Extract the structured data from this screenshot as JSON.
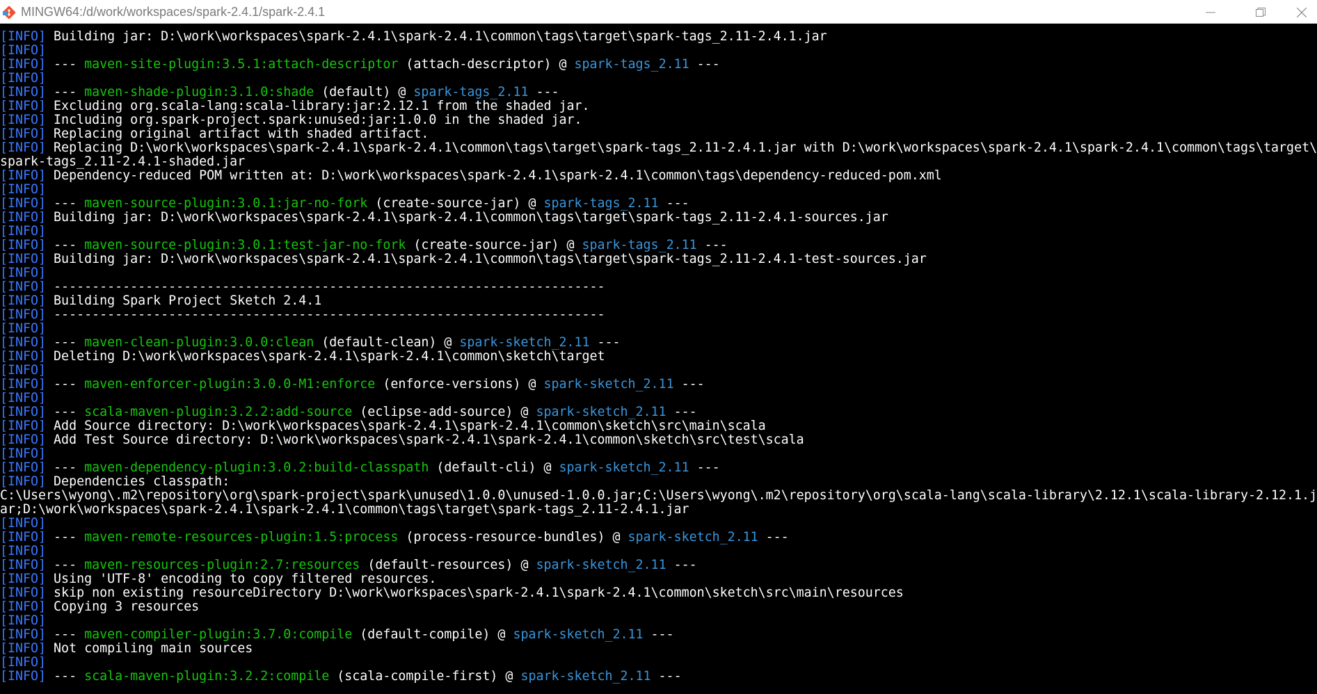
{
  "window": {
    "title": "MINGW64:/d/work/workspaces/spark-2.4.1/spark-2.4.1",
    "icon": "git-bash-icon",
    "buttons": [
      "minimize-icon",
      "maximize-icon",
      "close-icon"
    ]
  },
  "colors": {
    "background": "#000000",
    "text": "#ffffff",
    "info_tag": "#3b78ff",
    "plugin": "#16c60c",
    "artifact": "#3a96dd"
  },
  "terminal": {
    "lines": [
      {
        "tag": "[INFO]",
        "segments": [
          {
            "t": " Building jar: D:\\work\\workspaces\\spark-2.4.1\\spark-2.4.1\\common\\tags\\target\\spark-tags_2.11-2.4.1.jar",
            "c": "w"
          }
        ]
      },
      {
        "tag": "[INFO]",
        "segments": []
      },
      {
        "tag": "[INFO]",
        "segments": [
          {
            "t": " --- ",
            "c": "w"
          },
          {
            "t": "maven-site-plugin:3.5.1:attach-descriptor",
            "c": "g"
          },
          {
            "t": " (attach-descriptor) @ ",
            "c": "w"
          },
          {
            "t": "spark-tags_2.11",
            "c": "c"
          },
          {
            "t": " ---",
            "c": "w"
          }
        ]
      },
      {
        "tag": "[INFO]",
        "segments": []
      },
      {
        "tag": "[INFO]",
        "segments": [
          {
            "t": " --- ",
            "c": "w"
          },
          {
            "t": "maven-shade-plugin:3.1.0:shade",
            "c": "g"
          },
          {
            "t": " (default) @ ",
            "c": "w"
          },
          {
            "t": "spark-tags_2.11",
            "c": "c"
          },
          {
            "t": " ---",
            "c": "w"
          }
        ]
      },
      {
        "tag": "[INFO]",
        "segments": [
          {
            "t": " Excluding org.scala-lang:scala-library:jar:2.12.1 from the shaded jar.",
            "c": "w"
          }
        ]
      },
      {
        "tag": "[INFO]",
        "segments": [
          {
            "t": " Including org.spark-project.spark:unused:jar:1.0.0 in the shaded jar.",
            "c": "w"
          }
        ]
      },
      {
        "tag": "[INFO]",
        "segments": [
          {
            "t": " Replacing original artifact with shaded artifact.",
            "c": "w"
          }
        ]
      },
      {
        "tag": "[INFO]",
        "segments": [
          {
            "t": " Replacing D:\\work\\workspaces\\spark-2.4.1\\spark-2.4.1\\common\\tags\\target\\spark-tags_2.11-2.4.1.jar with D:\\work\\workspaces\\spark-2.4.1\\spark-2.4.1\\common\\tags\\target\\",
            "c": "w"
          }
        ]
      },
      {
        "tag": "",
        "segments": [
          {
            "t": "spark-tags_2.11-2.4.1-shaded.jar",
            "c": "w"
          }
        ]
      },
      {
        "tag": "[INFO]",
        "segments": [
          {
            "t": " Dependency-reduced POM written at: D:\\work\\workspaces\\spark-2.4.1\\spark-2.4.1\\common\\tags\\dependency-reduced-pom.xml",
            "c": "w"
          }
        ]
      },
      {
        "tag": "[INFO]",
        "segments": []
      },
      {
        "tag": "[INFO]",
        "segments": [
          {
            "t": " --- ",
            "c": "w"
          },
          {
            "t": "maven-source-plugin:3.0.1:jar-no-fork",
            "c": "g"
          },
          {
            "t": " (create-source-jar) @ ",
            "c": "w"
          },
          {
            "t": "spark-tags_2.11",
            "c": "c"
          },
          {
            "t": " ---",
            "c": "w"
          }
        ]
      },
      {
        "tag": "[INFO]",
        "segments": [
          {
            "t": " Building jar: D:\\work\\workspaces\\spark-2.4.1\\spark-2.4.1\\common\\tags\\target\\spark-tags_2.11-2.4.1-sources.jar",
            "c": "w"
          }
        ]
      },
      {
        "tag": "[INFO]",
        "segments": []
      },
      {
        "tag": "[INFO]",
        "segments": [
          {
            "t": " --- ",
            "c": "w"
          },
          {
            "t": "maven-source-plugin:3.0.1:test-jar-no-fork",
            "c": "g"
          },
          {
            "t": " (create-source-jar) @ ",
            "c": "w"
          },
          {
            "t": "spark-tags_2.11",
            "c": "c"
          },
          {
            "t": " ---",
            "c": "w"
          }
        ]
      },
      {
        "tag": "[INFO]",
        "segments": [
          {
            "t": " Building jar: D:\\work\\workspaces\\spark-2.4.1\\spark-2.4.1\\common\\tags\\target\\spark-tags_2.11-2.4.1-test-sources.jar",
            "c": "w"
          }
        ]
      },
      {
        "tag": "[INFO]",
        "segments": []
      },
      {
        "tag": "[INFO]",
        "segments": [
          {
            "t": " ------------------------------------------------------------------------",
            "c": "w"
          }
        ]
      },
      {
        "tag": "[INFO]",
        "segments": [
          {
            "t": " Building Spark Project Sketch 2.4.1",
            "c": "w"
          }
        ]
      },
      {
        "tag": "[INFO]",
        "segments": [
          {
            "t": " ------------------------------------------------------------------------",
            "c": "w"
          }
        ]
      },
      {
        "tag": "[INFO]",
        "segments": []
      },
      {
        "tag": "[INFO]",
        "segments": [
          {
            "t": " --- ",
            "c": "w"
          },
          {
            "t": "maven-clean-plugin:3.0.0:clean",
            "c": "g"
          },
          {
            "t": " (default-clean) @ ",
            "c": "w"
          },
          {
            "t": "spark-sketch_2.11",
            "c": "c"
          },
          {
            "t": " ---",
            "c": "w"
          }
        ]
      },
      {
        "tag": "[INFO]",
        "segments": [
          {
            "t": " Deleting D:\\work\\workspaces\\spark-2.4.1\\spark-2.4.1\\common\\sketch\\target",
            "c": "w"
          }
        ]
      },
      {
        "tag": "[INFO]",
        "segments": []
      },
      {
        "tag": "[INFO]",
        "segments": [
          {
            "t": " --- ",
            "c": "w"
          },
          {
            "t": "maven-enforcer-plugin:3.0.0-M1:enforce",
            "c": "g"
          },
          {
            "t": " (enforce-versions) @ ",
            "c": "w"
          },
          {
            "t": "spark-sketch_2.11",
            "c": "c"
          },
          {
            "t": " ---",
            "c": "w"
          }
        ]
      },
      {
        "tag": "[INFO]",
        "segments": []
      },
      {
        "tag": "[INFO]",
        "segments": [
          {
            "t": " --- ",
            "c": "w"
          },
          {
            "t": "scala-maven-plugin:3.2.2:add-source",
            "c": "g"
          },
          {
            "t": " (eclipse-add-source) @ ",
            "c": "w"
          },
          {
            "t": "spark-sketch_2.11",
            "c": "c"
          },
          {
            "t": " ---",
            "c": "w"
          }
        ]
      },
      {
        "tag": "[INFO]",
        "segments": [
          {
            "t": " Add Source directory: D:\\work\\workspaces\\spark-2.4.1\\spark-2.4.1\\common\\sketch\\src\\main\\scala",
            "c": "w"
          }
        ]
      },
      {
        "tag": "[INFO]",
        "segments": [
          {
            "t": " Add Test Source directory: D:\\work\\workspaces\\spark-2.4.1\\spark-2.4.1\\common\\sketch\\src\\test\\scala",
            "c": "w"
          }
        ]
      },
      {
        "tag": "[INFO]",
        "segments": []
      },
      {
        "tag": "[INFO]",
        "segments": [
          {
            "t": " --- ",
            "c": "w"
          },
          {
            "t": "maven-dependency-plugin:3.0.2:build-classpath",
            "c": "g"
          },
          {
            "t": " (default-cli) @ ",
            "c": "w"
          },
          {
            "t": "spark-sketch_2.11",
            "c": "c"
          },
          {
            "t": " ---",
            "c": "w"
          }
        ]
      },
      {
        "tag": "[INFO]",
        "segments": [
          {
            "t": " Dependencies classpath:",
            "c": "w"
          }
        ]
      },
      {
        "tag": "",
        "segments": [
          {
            "t": "C:\\Users\\wyong\\.m2\\repository\\org\\spark-project\\spark\\unused\\1.0.0\\unused-1.0.0.jar;C:\\Users\\wyong\\.m2\\repository\\org\\scala-lang\\scala-library\\2.12.1\\scala-library-2.12.1.j",
            "c": "w"
          }
        ]
      },
      {
        "tag": "",
        "segments": [
          {
            "t": "ar;D:\\work\\workspaces\\spark-2.4.1\\spark-2.4.1\\common\\tags\\target\\spark-tags_2.11-2.4.1.jar",
            "c": "w"
          }
        ]
      },
      {
        "tag": "[INFO]",
        "segments": []
      },
      {
        "tag": "[INFO]",
        "segments": [
          {
            "t": " --- ",
            "c": "w"
          },
          {
            "t": "maven-remote-resources-plugin:1.5:process",
            "c": "g"
          },
          {
            "t": " (process-resource-bundles) @ ",
            "c": "w"
          },
          {
            "t": "spark-sketch_2.11",
            "c": "c"
          },
          {
            "t": " ---",
            "c": "w"
          }
        ]
      },
      {
        "tag": "[INFO]",
        "segments": []
      },
      {
        "tag": "[INFO]",
        "segments": [
          {
            "t": " --- ",
            "c": "w"
          },
          {
            "t": "maven-resources-plugin:2.7:resources",
            "c": "g"
          },
          {
            "t": " (default-resources) @ ",
            "c": "w"
          },
          {
            "t": "spark-sketch_2.11",
            "c": "c"
          },
          {
            "t": " ---",
            "c": "w"
          }
        ]
      },
      {
        "tag": "[INFO]",
        "segments": [
          {
            "t": " Using 'UTF-8' encoding to copy filtered resources.",
            "c": "w"
          }
        ]
      },
      {
        "tag": "[INFO]",
        "segments": [
          {
            "t": " skip non existing resourceDirectory D:\\work\\workspaces\\spark-2.4.1\\spark-2.4.1\\common\\sketch\\src\\main\\resources",
            "c": "w"
          }
        ]
      },
      {
        "tag": "[INFO]",
        "segments": [
          {
            "t": " Copying 3 resources",
            "c": "w"
          }
        ]
      },
      {
        "tag": "[INFO]",
        "segments": []
      },
      {
        "tag": "[INFO]",
        "segments": [
          {
            "t": " --- ",
            "c": "w"
          },
          {
            "t": "maven-compiler-plugin:3.7.0:compile",
            "c": "g"
          },
          {
            "t": " (default-compile) @ ",
            "c": "w"
          },
          {
            "t": "spark-sketch_2.11",
            "c": "c"
          },
          {
            "t": " ---",
            "c": "w"
          }
        ]
      },
      {
        "tag": "[INFO]",
        "segments": [
          {
            "t": " Not compiling main sources",
            "c": "w"
          }
        ]
      },
      {
        "tag": "[INFO]",
        "segments": []
      },
      {
        "tag": "[INFO]",
        "segments": [
          {
            "t": " --- ",
            "c": "w"
          },
          {
            "t": "scala-maven-plugin:3.2.2:compile",
            "c": "g"
          },
          {
            "t": " (scala-compile-first) @ ",
            "c": "w"
          },
          {
            "t": "spark-sketch_2.11",
            "c": "c"
          },
          {
            "t": " ---",
            "c": "w"
          }
        ]
      }
    ]
  }
}
